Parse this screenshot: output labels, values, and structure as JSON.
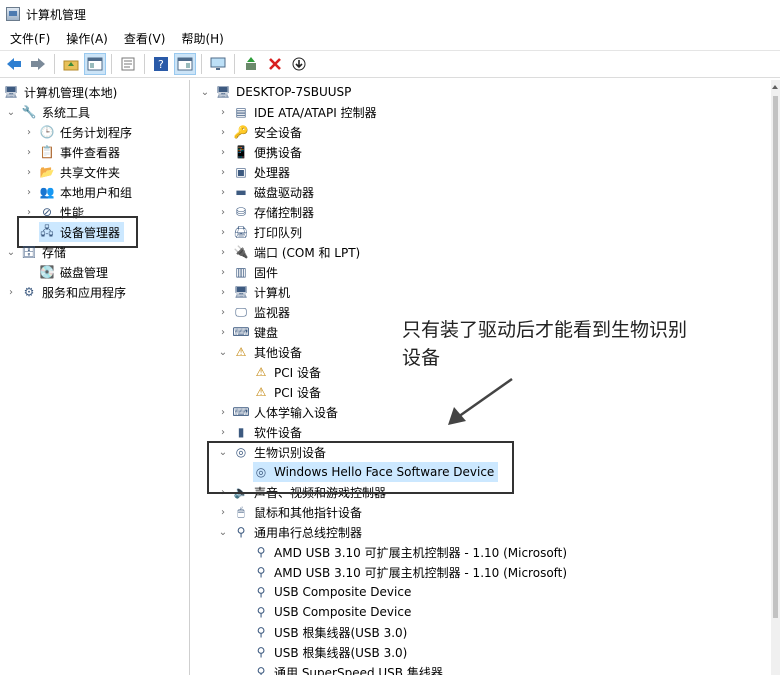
{
  "window": {
    "title": "计算机管理"
  },
  "menu": [
    "文件(F)",
    "操作(A)",
    "查看(V)",
    "帮助(H)"
  ],
  "left_tree": {
    "root": "计算机管理(本地)",
    "items": [
      {
        "label": "系统工具",
        "level": 1,
        "expanded": true
      },
      {
        "label": "任务计划程序",
        "level": 2
      },
      {
        "label": "事件查看器",
        "level": 2
      },
      {
        "label": "共享文件夹",
        "level": 2
      },
      {
        "label": "本地用户和组",
        "level": 2
      },
      {
        "label": "性能",
        "level": 2
      },
      {
        "label": "设备管理器",
        "level": 2,
        "selected": true
      },
      {
        "label": "存储",
        "level": 1,
        "expanded": true
      },
      {
        "label": "磁盘管理",
        "level": 2
      },
      {
        "label": "服务和应用程序",
        "level": 1
      }
    ]
  },
  "device_tree": {
    "root": "DESKTOP-7SBUUSP",
    "categories": [
      "IDE ATA/ATAPI 控制器",
      "安全设备",
      "便携设备",
      "处理器",
      "磁盘驱动器",
      "存储控制器",
      "打印队列",
      "端口 (COM 和 LPT)",
      "固件",
      "计算机",
      "监视器",
      "键盘",
      "其他设备",
      "PCI 设备",
      "PCI 设备",
      "人体学输入设备",
      "软件设备",
      "生物识别设备",
      "Windows Hello Face Software Device",
      "声音、视频和游戏控制器",
      "鼠标和其他指针设备",
      "通用串行总线控制器",
      "AMD USB 3.10 可扩展主机控制器 - 1.10 (Microsoft)",
      "AMD USB 3.10 可扩展主机控制器 - 1.10 (Microsoft)",
      "USB Composite Device",
      "USB Composite Device",
      "USB 根集线器(USB 3.0)",
      "USB 根集线器(USB 3.0)",
      "通用 SuperSpeed USB 集线器"
    ]
  },
  "annotation": {
    "line1": "只有装了驱动后才能看到生物识别",
    "line2": "设备"
  }
}
